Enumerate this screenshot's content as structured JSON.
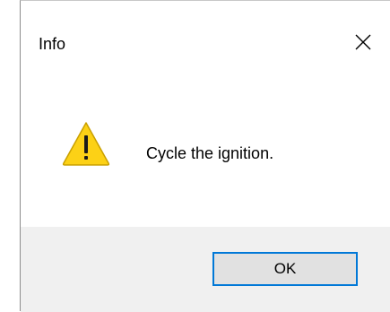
{
  "dialog": {
    "title": "Info",
    "message": "Cycle the ignition.",
    "icon": "warning-icon",
    "close_icon": "close-icon",
    "buttons": {
      "ok_label": "OK"
    }
  },
  "colors": {
    "warning_fill": "#fcd116",
    "warning_outline": "#c9a000",
    "button_border": "#0078d7",
    "footer_bg": "#f0f0f0"
  }
}
